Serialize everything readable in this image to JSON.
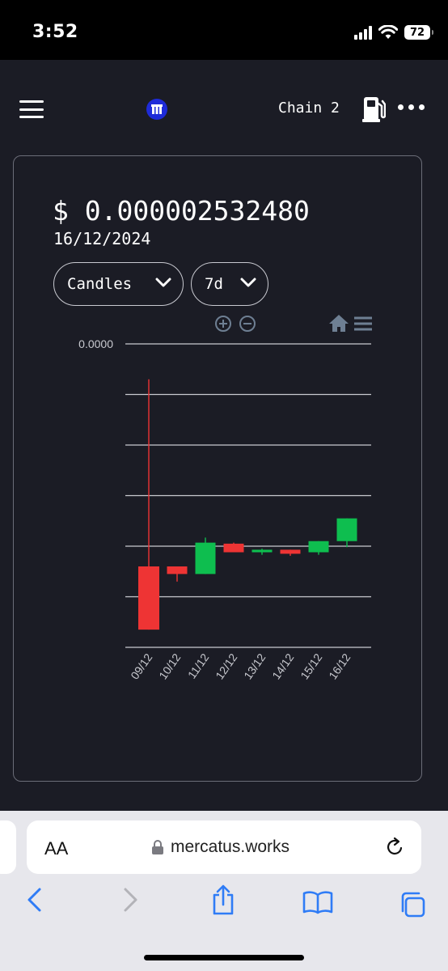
{
  "status": {
    "time": "3:52",
    "battery": "72"
  },
  "header": {
    "chain_label": "Chain 2"
  },
  "icons": {
    "menu": "hamburger-menu-icon",
    "logo": "mercatus-logo-icon",
    "gas": "gas-pump-icon",
    "more": "more-horizontal-icon",
    "zoom_in": "zoom-in-icon",
    "zoom_out": "zoom-out-icon",
    "home": "home-icon",
    "chart_menu": "chart-menu-icon"
  },
  "card": {
    "price": "$ 0.000002532480",
    "date": "16/12/2024",
    "chart_type": {
      "selected": "Candles"
    },
    "range": {
      "selected": "7d"
    }
  },
  "colors": {
    "up": "#0ebe4f",
    "down": "#ee3434",
    "grid": "#c9cad0",
    "axis_text": "#c9cad0",
    "toolbar": "#6e7f93"
  },
  "chart_data": {
    "type": "candlestick",
    "y_tick_labels": [
      "0.0000"
    ],
    "grid": true,
    "ylim": [
      0,
      6
    ],
    "categories": [
      "09/12",
      "10/12",
      "11/12",
      "12/12",
      "13/12",
      "14/12",
      "15/12",
      "16/12"
    ],
    "ohlc": [
      {
        "open": 1.6,
        "high": 5.3,
        "low": 0.35,
        "close": 0.35
      },
      {
        "open": 1.6,
        "high": 1.6,
        "low": 1.3,
        "close": 1.45
      },
      {
        "open": 1.45,
        "high": 2.17,
        "low": 1.45,
        "close": 2.07
      },
      {
        "open": 2.05,
        "high": 2.07,
        "low": 1.88,
        "close": 1.88
      },
      {
        "open": 1.88,
        "high": 1.95,
        "low": 1.83,
        "close": 1.93
      },
      {
        "open": 1.93,
        "high": 1.93,
        "low": 1.81,
        "close": 1.85
      },
      {
        "open": 1.88,
        "high": 2.1,
        "low": 1.83,
        "close": 2.1
      },
      {
        "open": 2.1,
        "high": 2.55,
        "low": 1.98,
        "close": 2.55
      }
    ]
  },
  "browser": {
    "domain": "mercatus.works",
    "aa_label": "AA"
  }
}
